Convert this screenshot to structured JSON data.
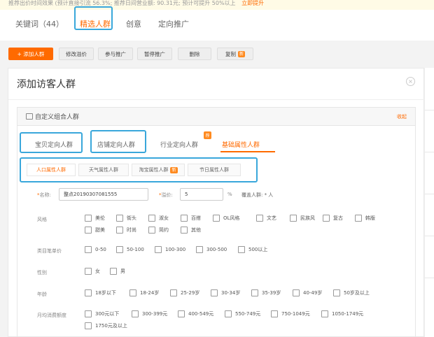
{
  "notice": {
    "text": "推荐出价时间效果 (预计直接引流 56.3%; 推荐日间营业额: 90.31元; 预计可提升 50%以上",
    "link": "立即提升"
  },
  "tabs": [
    {
      "label": "关键词（44）"
    },
    {
      "label": "精选人群"
    },
    {
      "label": "创意"
    },
    {
      "label": "定向推广"
    }
  ],
  "toolbar": {
    "add": "+ 添加人群",
    "modify": "修改溢价",
    "join": "参与推广",
    "pause": "暂停推广",
    "delete": "删除",
    "copy": "复制",
    "copy_badge": "新"
  },
  "modal": {
    "title": "添加访客人群",
    "close": "×",
    "card": {
      "title": "自定义组合人群",
      "collapse": "收起",
      "tabs": [
        "宝贝定向人群",
        "店铺定向人群",
        "行业定向人群",
        "基础属性人群"
      ],
      "tab_badge": "荐",
      "subtabs": [
        "人口属性人群",
        "天气属性人群",
        "淘宝属性人群",
        "节日属性人群"
      ],
      "subtab_badge": "新",
      "form": {
        "name_label": "名称:",
        "name_value": "整点20190307081555",
        "premium_label": "溢价:",
        "premium_value": "5",
        "premium_unit": "%",
        "coverage": "覆盖人群: * 人",
        "style_label": "风格",
        "style_options": [
          "美伦",
          "街头",
          "淑女",
          "百搭",
          "OL风格",
          "文艺",
          "民族风",
          "复古",
          "韩版",
          "甜美",
          "时尚",
          "简约",
          "其他"
        ],
        "price_label": "类目笔单价",
        "price_options": [
          "0-50",
          "50-100",
          "100-300",
          "300-500",
          "500以上"
        ],
        "gender_label": "性别",
        "gender_options": [
          "女",
          "男"
        ],
        "age_label": "年龄",
        "age_options": [
          "18岁以下",
          "18-24岁",
          "25-29岁",
          "30-34岁",
          "35-39岁",
          "40-49岁",
          "50岁及以上"
        ],
        "spend_label": "月均消费额度",
        "spend_options": [
          "300元以下",
          "300-399元",
          "400-549元",
          "550-749元",
          "750-1049元",
          "1050-1749元",
          "1750元及以上"
        ]
      }
    }
  },
  "colors": {
    "accent": "#ff6a00",
    "highlight": "#39a7db"
  },
  "icons": {
    "close": "close-icon",
    "card": "group-icon",
    "checkbox": "checkbox-icon"
  }
}
